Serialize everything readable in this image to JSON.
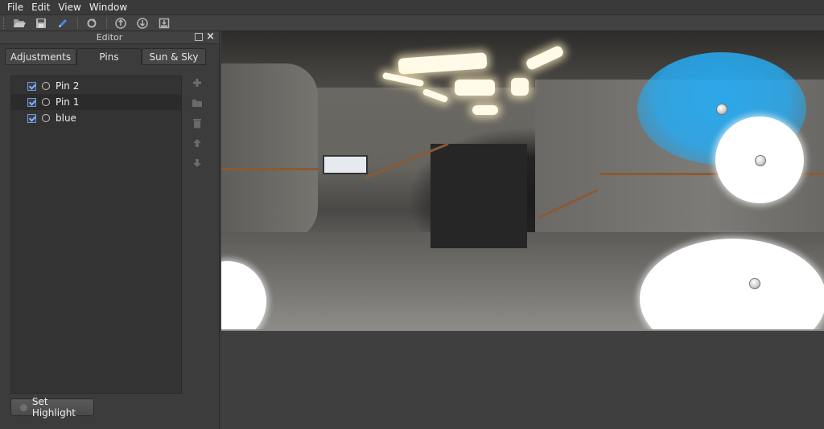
{
  "menubar": {
    "items": [
      {
        "label": "File"
      },
      {
        "label": "Edit"
      },
      {
        "label": "View"
      },
      {
        "label": "Window"
      }
    ]
  },
  "toolbar": {
    "buttons": [
      {
        "icon": "open-folder-icon"
      },
      {
        "icon": "save-icon"
      },
      {
        "icon": "pencil-icon"
      },
      {
        "icon": "refresh-icon"
      },
      {
        "icon": "export-up-icon"
      },
      {
        "icon": "export-down-icon"
      },
      {
        "icon": "import-icon"
      }
    ]
  },
  "editor": {
    "title": "Editor",
    "tabs": [
      {
        "label": "Adjustments"
      },
      {
        "label": "Pins"
      },
      {
        "label": "Sun & Sky"
      }
    ],
    "active_tab": "Pins",
    "pins": [
      {
        "name": "Pin 2",
        "checked": true,
        "selected": false
      },
      {
        "name": "Pin 1",
        "checked": true,
        "selected": true
      },
      {
        "name": "blue",
        "checked": true,
        "selected": false
      }
    ],
    "side_tools": [
      {
        "icon": "add-icon"
      },
      {
        "icon": "folder-icon"
      },
      {
        "icon": "trash-icon"
      },
      {
        "icon": "arrow-up-icon"
      },
      {
        "icon": "arrow-down-icon"
      }
    ],
    "set_highlight_label": "Set Highlight"
  },
  "colors": {
    "accent_blue": "#28aaf0",
    "panel_bg": "#3c3c3c",
    "list_bg": "#333333"
  }
}
